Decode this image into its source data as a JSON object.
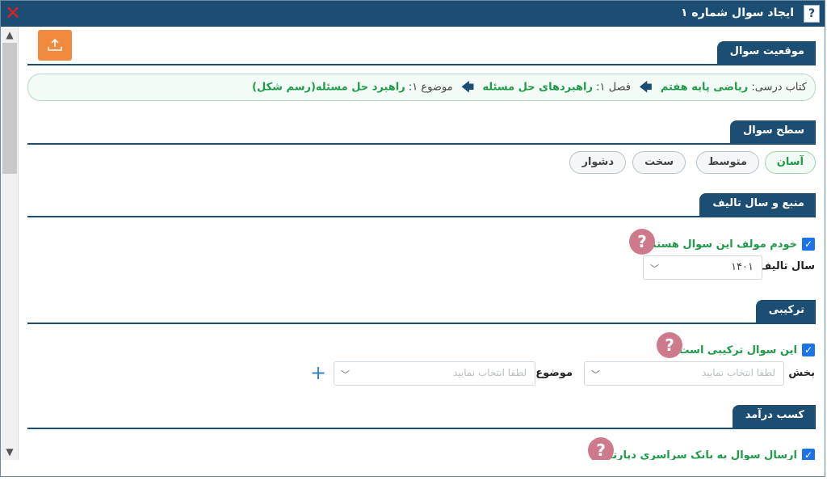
{
  "window": {
    "title": "ایجاد سوال شماره ۱",
    "help": "?",
    "close": "✕"
  },
  "sections": {
    "location": "موقعیت سوال",
    "level": "سطح سوال",
    "source": "منبع و سال تالیف",
    "composite": "ترکیبی",
    "income": "کسب درآمد"
  },
  "breadcrumb": {
    "book_label": "کتاب درسی:",
    "book_value": "ریاضی پایه هفتم",
    "chapter_label": "فصل ۱:",
    "chapter_value": "راهبردهای حل مسئله",
    "topic_label": "موضوع ۱:",
    "topic_value": "راهبرد حل مسئله(رسم شکل)"
  },
  "levels": [
    "آسان",
    "متوسط",
    "سخت",
    "دشوار"
  ],
  "source": {
    "author_check": "خودم مولف این سوال هستم",
    "year_label": "سال تالیف",
    "year_value": "۱۴۰۱"
  },
  "composite": {
    "check_label": "این سوال ترکیبی است",
    "section_label": "بخش",
    "section_placeholder": "لطفا انتخاب نمایید",
    "topic_label": "موضوع",
    "topic_placeholder": "لطفا انتخاب نمایید",
    "add": "+"
  },
  "income": {
    "send_check": "ارسال سوال به بانک سراسری دپارتمان"
  },
  "colors": {
    "header": "#1b4e72",
    "accent_green": "#1f9a4a",
    "upload": "#f08a3c",
    "help_bubble": "#cf7a8c"
  }
}
